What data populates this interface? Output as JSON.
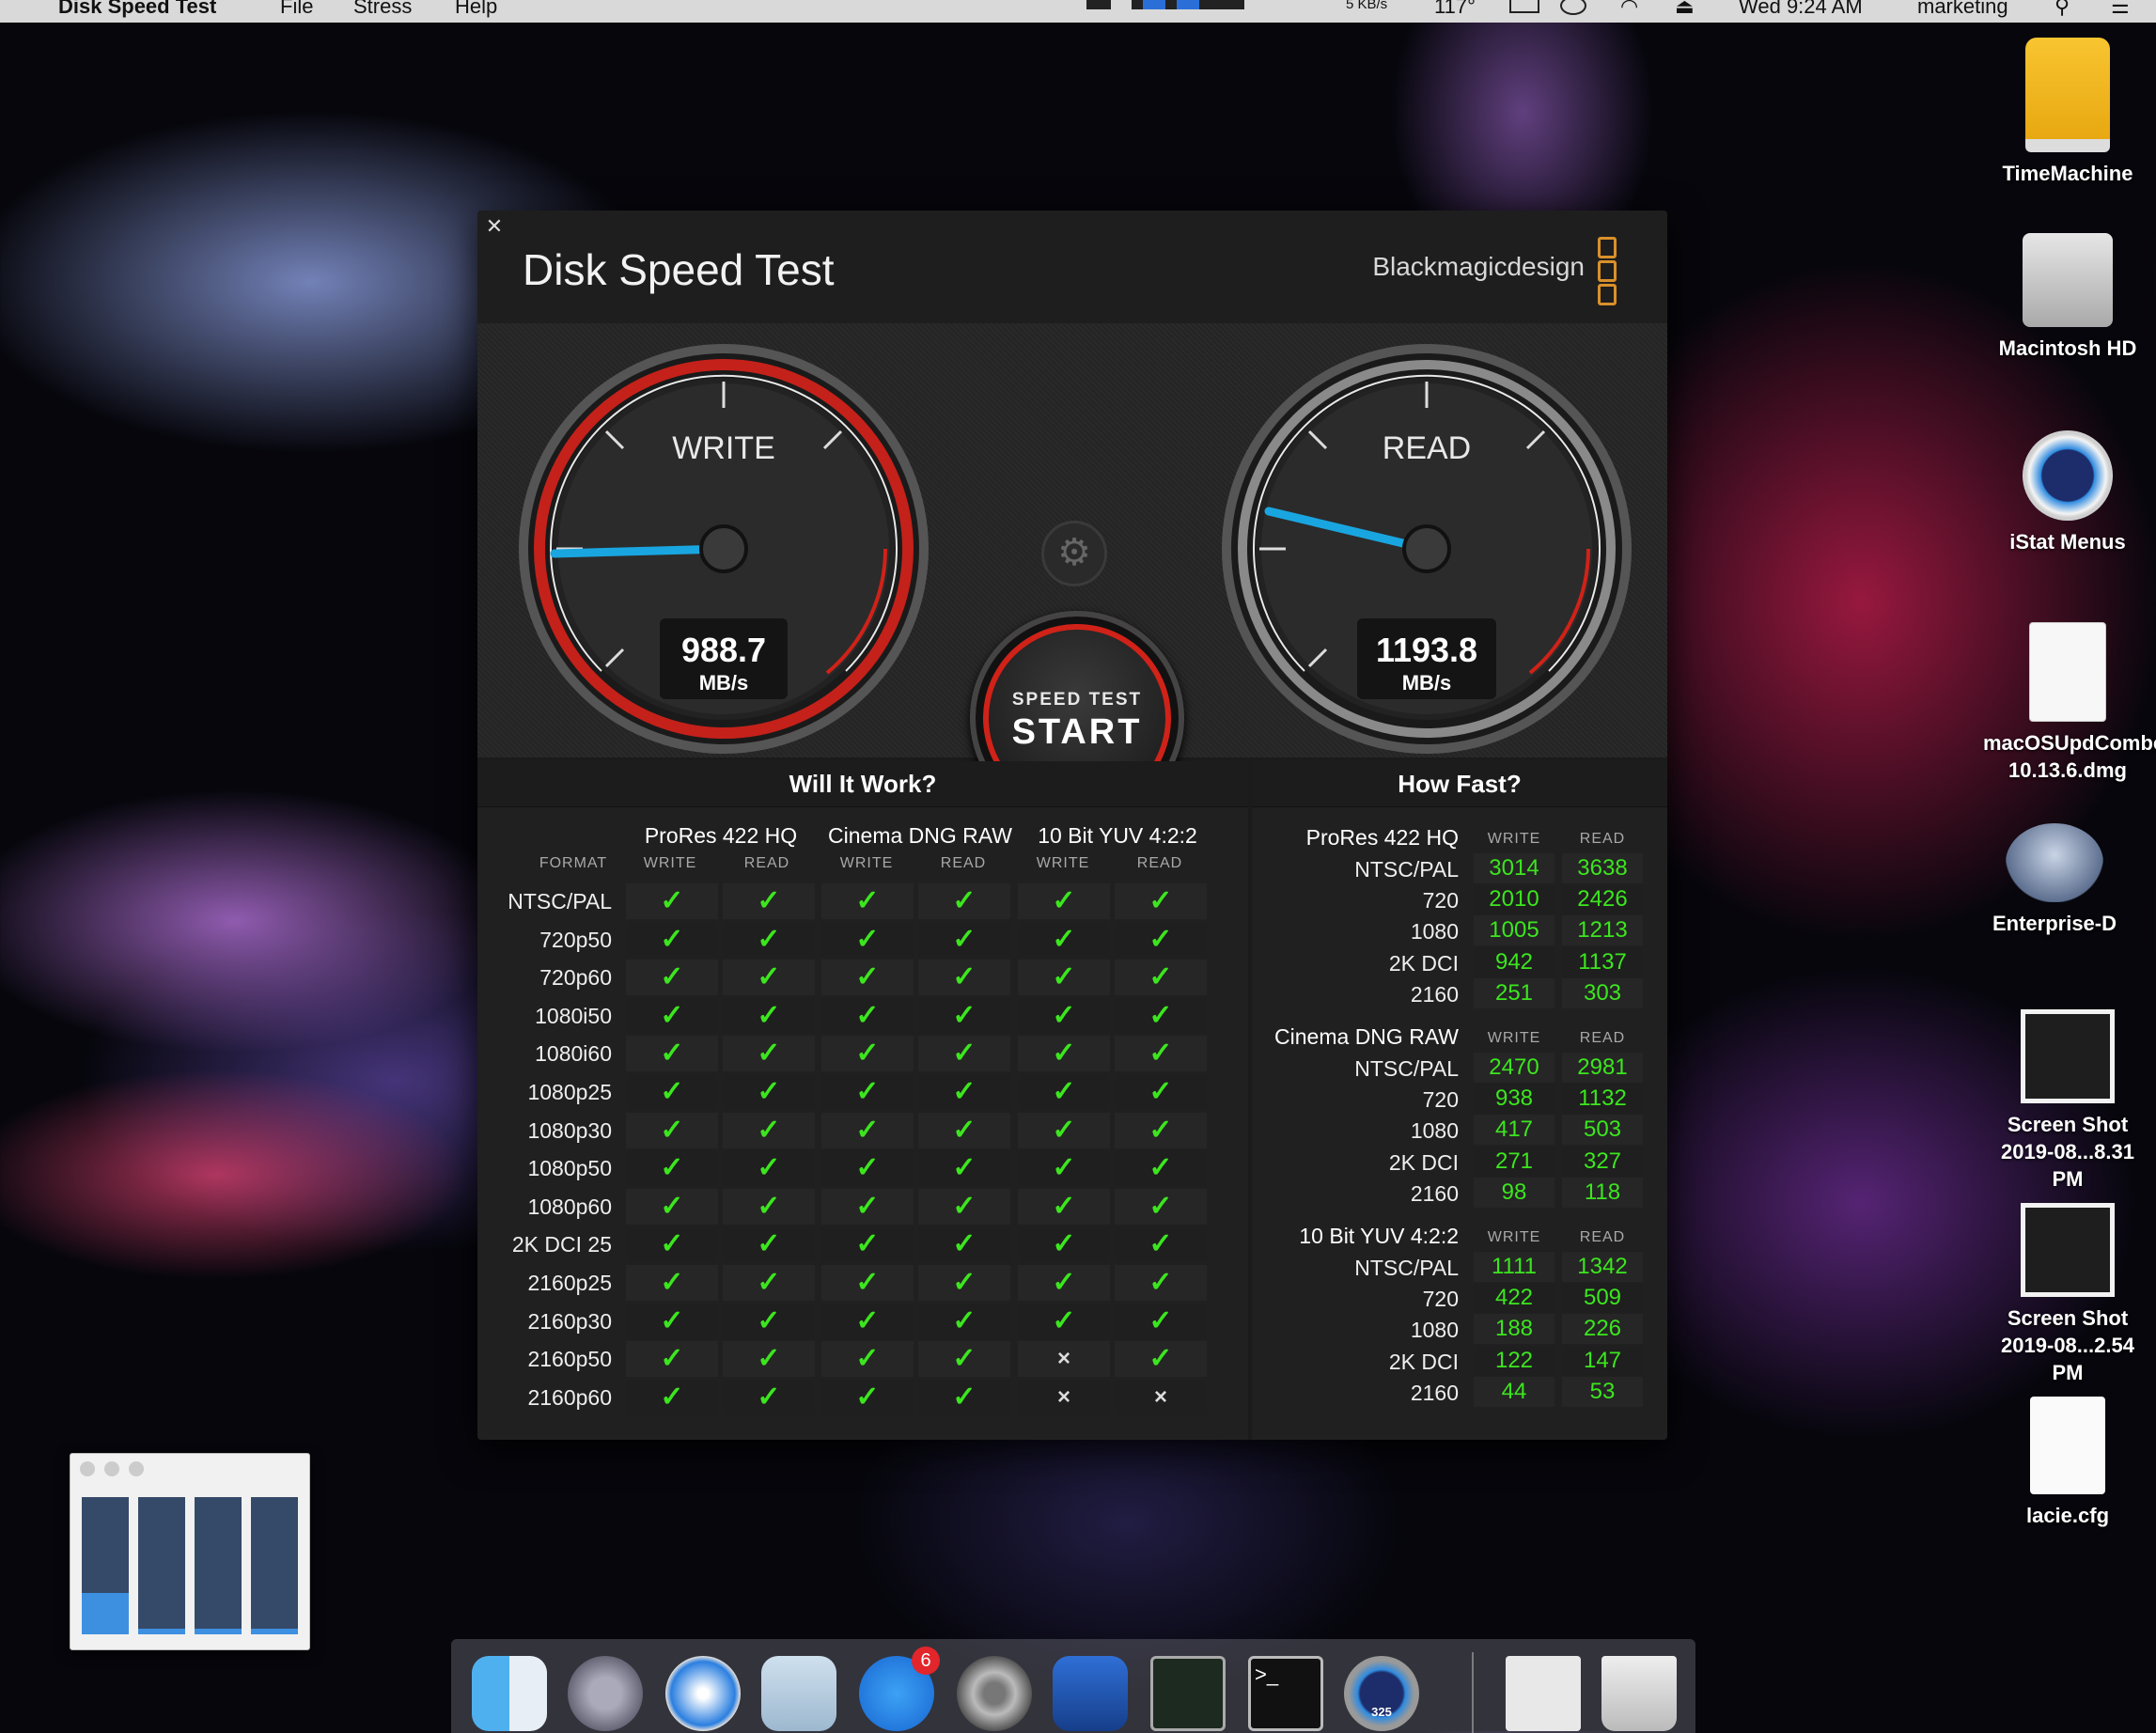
{
  "menubar": {
    "app_name": "Disk Speed Test",
    "menus": [
      "File",
      "Stress",
      "Help"
    ],
    "net_rate": "5 KB/s",
    "temp": "117°",
    "clock": "Wed 9:24 AM",
    "user": "marketing"
  },
  "desktop_icons": [
    {
      "label": "TimeMachine",
      "icon": "external-drive-icon"
    },
    {
      "label": "Macintosh HD",
      "icon": "internal-drive-icon"
    },
    {
      "label": "iStat Menus",
      "icon": "istat-menus-icon"
    },
    {
      "label": "macOSUpdCombo10.13.6.dmg",
      "line1": "macOSUpdCombo",
      "line2": "10.13.6.dmg",
      "icon": "dmg-file-icon"
    },
    {
      "label": "Enterprise-D",
      "icon": "starship-icon"
    },
    {
      "label": "Screen Shot 2019-08...8.31 PM",
      "line1": "Screen Shot",
      "line2": "2019-08...8.31 PM",
      "icon": "screenshot-thumbnail-icon"
    },
    {
      "label": "Screen Shot 2019-08...2.54 PM",
      "line1": "Screen Shot",
      "line2": "2019-08...2.54 PM",
      "icon": "screenshot-thumbnail-icon"
    },
    {
      "label": "lacie.cfg",
      "icon": "document-icon"
    }
  ],
  "window": {
    "title": "Disk Speed Test",
    "brand": "Blackmagicdesign",
    "brand_color": "#d9902a",
    "close_glyph": "✕"
  },
  "gauges": {
    "write": {
      "label": "WRITE",
      "value": "988.7",
      "unit": "MB/s"
    },
    "read": {
      "label": "READ",
      "value": "1193.8",
      "unit": "MB/s"
    },
    "needle_color": "#19a6e0",
    "accent_red": "#d02218"
  },
  "start_button": {
    "small": "SPEED TEST",
    "big": "START"
  },
  "will_it_work": {
    "title": "Will It Work?",
    "format_label": "FORMAT",
    "groups": [
      "ProRes 422 HQ",
      "Cinema DNG RAW",
      "10 Bit YUV 4:2:2"
    ],
    "sub_write": "WRITE",
    "sub_read": "READ",
    "rows": [
      {
        "format": "NTSC/PAL",
        "cells": [
          1,
          1,
          1,
          1,
          1,
          1
        ]
      },
      {
        "format": "720p50",
        "cells": [
          1,
          1,
          1,
          1,
          1,
          1
        ]
      },
      {
        "format": "720p60",
        "cells": [
          1,
          1,
          1,
          1,
          1,
          1
        ]
      },
      {
        "format": "1080i50",
        "cells": [
          1,
          1,
          1,
          1,
          1,
          1
        ]
      },
      {
        "format": "1080i60",
        "cells": [
          1,
          1,
          1,
          1,
          1,
          1
        ]
      },
      {
        "format": "1080p25",
        "cells": [
          1,
          1,
          1,
          1,
          1,
          1
        ]
      },
      {
        "format": "1080p30",
        "cells": [
          1,
          1,
          1,
          1,
          1,
          1
        ]
      },
      {
        "format": "1080p50",
        "cells": [
          1,
          1,
          1,
          1,
          1,
          1
        ]
      },
      {
        "format": "1080p60",
        "cells": [
          1,
          1,
          1,
          1,
          1,
          1
        ]
      },
      {
        "format": "2K DCI 25",
        "cells": [
          1,
          1,
          1,
          1,
          1,
          1
        ]
      },
      {
        "format": "2160p25",
        "cells": [
          1,
          1,
          1,
          1,
          1,
          1
        ]
      },
      {
        "format": "2160p30",
        "cells": [
          1,
          1,
          1,
          1,
          1,
          1
        ]
      },
      {
        "format": "2160p50",
        "cells": [
          1,
          1,
          1,
          1,
          0,
          1
        ]
      },
      {
        "format": "2160p60",
        "cells": [
          1,
          1,
          1,
          1,
          0,
          0
        ]
      }
    ],
    "check_glyph": "✓",
    "cross_glyph": "×",
    "ok_color": "#3ce61e"
  },
  "how_fast": {
    "title": "How Fast?",
    "sub_write": "WRITE",
    "sub_read": "READ",
    "sections": [
      {
        "name": "ProRes 422 HQ",
        "rows": [
          {
            "format": "NTSC/PAL",
            "write": "3014",
            "read": "3638"
          },
          {
            "format": "720",
            "write": "2010",
            "read": "2426"
          },
          {
            "format": "1080",
            "write": "1005",
            "read": "1213"
          },
          {
            "format": "2K DCI",
            "write": "942",
            "read": "1137"
          },
          {
            "format": "2160",
            "write": "251",
            "read": "303"
          }
        ]
      },
      {
        "name": "Cinema DNG RAW",
        "rows": [
          {
            "format": "NTSC/PAL",
            "write": "2470",
            "read": "2981"
          },
          {
            "format": "720",
            "write": "938",
            "read": "1132"
          },
          {
            "format": "1080",
            "write": "417",
            "read": "503"
          },
          {
            "format": "2K DCI",
            "write": "271",
            "read": "327"
          },
          {
            "format": "2160",
            "write": "98",
            "read": "118"
          }
        ]
      },
      {
        "name": "10 Bit YUV 4:2:2",
        "rows": [
          {
            "format": "NTSC/PAL",
            "write": "1111",
            "read": "1342"
          },
          {
            "format": "720",
            "write": "422",
            "read": "509"
          },
          {
            "format": "1080",
            "write": "188",
            "read": "226"
          },
          {
            "format": "2K DCI",
            "write": "122",
            "read": "147"
          },
          {
            "format": "2160",
            "write": "44",
            "read": "53"
          }
        ]
      }
    ]
  },
  "dock": {
    "apps": [
      "finder-icon",
      "launchpad-icon",
      "safari-icon",
      "mail-icon",
      "app-store-icon",
      "system-preferences-icon",
      "disk-speed-test-icon",
      "activity-monitor-icon",
      "terminal-icon",
      "istat-menus-icon",
      "downloads-stack-icon",
      "trash-icon"
    ],
    "app_store_badge": "6",
    "istat_readout": "325"
  }
}
